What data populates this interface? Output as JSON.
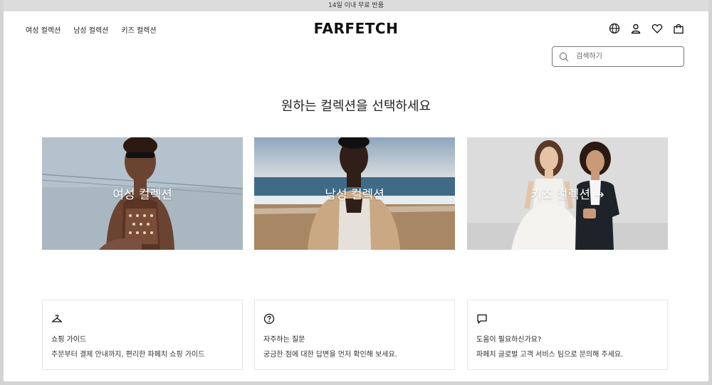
{
  "announcement": "14일 이내 무료 반품",
  "nav": {
    "links": [
      "여성 컬렉션",
      "남성 컬렉션",
      "키즈 컬렉션"
    ]
  },
  "brand": {
    "logo": "FARFETCH"
  },
  "header_icons": [
    "globe-icon",
    "user-icon",
    "heart-icon",
    "bag-icon"
  ],
  "search": {
    "placeholder": "검색하기"
  },
  "main": {
    "heading": "원하는 컬렉션을 선택하세요",
    "collections": [
      {
        "label": "여성 컬렉션"
      },
      {
        "label": "남성 컬렉션"
      },
      {
        "label": "키즈 컬렉션 →"
      }
    ]
  },
  "info_cards": [
    {
      "icon": "hanger-icon",
      "title": "쇼핑 가이드",
      "desc": "주문부터 결제 안내까지, 편리한 파페치 쇼핑 가이드"
    },
    {
      "icon": "question-icon",
      "title": "자주하는 질문",
      "desc": "궁금한 점에 대한 답변을 먼저 확인해 보세요."
    },
    {
      "icon": "chat-icon",
      "title": "도움이 필요하신가요?",
      "desc": "파페치 글로벌 고객 서비스 팀으로 문의해 주세요."
    }
  ],
  "colors": {
    "text": "#222222",
    "border": "#e6e6e6",
    "announce_bg": "#dcdcdc"
  }
}
